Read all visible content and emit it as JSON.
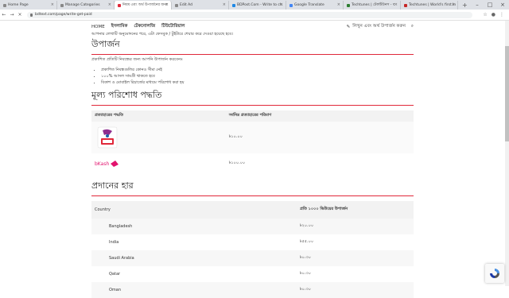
{
  "browser": {
    "tabs": [
      {
        "label": "Home Page",
        "fav": "#5b7bd5"
      },
      {
        "label": "Manage Categories",
        "fav": "#3c8dbc"
      },
      {
        "label": "নিয়ম এবং অর্থ উপার্জনের জন্য",
        "fav": "#e0283a",
        "active": true
      },
      {
        "label": "Edit Ad",
        "fav": "#555555"
      },
      {
        "label": "BDPost.Com - Write to ch",
        "fav": "#1e88e5"
      },
      {
        "label": "Google Translate",
        "fav": "#4285f4"
      },
      {
        "label": "Techtunes | টেকটিউনস - ব",
        "fav": "#2e7d32"
      },
      {
        "label": "Techtunes | World's first in",
        "fav": "#c62828"
      }
    ],
    "new_tab": "+",
    "url": "bdtext.com/page/write-get-paid"
  },
  "site_nav": {
    "items": [
      "HOME",
      "ইসলামিক",
      "টেকনোলজি",
      "টিউটোরিয়াল"
    ],
    "right_label": "লিখুন এবং অর্থ উপার্জন করুন"
  },
  "content": {
    "top_cut_text": "আপনার লেখাটি অনুমোদনের পরে, এটা ফেসবুক / টুইটারে শেয়ার করে দেওয়া হয়েছে হবে।",
    "earnings_title": "উপার্জন",
    "earnings_intro": "প্রকাশিত প্রতিটি নিবন্ধের জন্য আপনি উপার্জন করবেনঃ",
    "earnings_points": [
      "প্রকাশিত নিবন্ধগুলির কোনও সীমা নেই",
      "১০০% আসল সামগ্রী থাকতে হবে",
      "বিকাশ ও মোবাইল রিচার্জের মাধ্যমে পরিশোধ করা হয়"
    ],
    "payment_title": "মূল্য পরিশোধ পদ্ধতি",
    "payment_headers": [
      "প্রত্যাহারের পদ্ধতি",
      "সর্বনিম্ন প্রত্যাহারের পরিমাণ"
    ],
    "payment_rows": [
      {
        "method": "Rocket",
        "amount": "৳১০.০০"
      },
      {
        "method": "bKash",
        "amount": "৳১০০.০০"
      }
    ],
    "rate_title": "প্রদানের হার",
    "rate_headers": [
      "Country",
      "প্রতি ১০০০ ভিউয়ের উপার্জন"
    ],
    "rate_rows": [
      {
        "country": "Bangladesh",
        "rate": "৳২০.০০"
      },
      {
        "country": "India",
        "rate": "৳৫৫.০০"
      },
      {
        "country": "Saudi Arabia",
        "rate": "৳০.৩০"
      },
      {
        "country": "Qatar",
        "rate": "৳০.৩০"
      },
      {
        "country": "Oman",
        "rate": "৳০.৩০"
      }
    ]
  },
  "colors": {
    "accent": "#e0283a",
    "bkash": "#e2136e"
  }
}
